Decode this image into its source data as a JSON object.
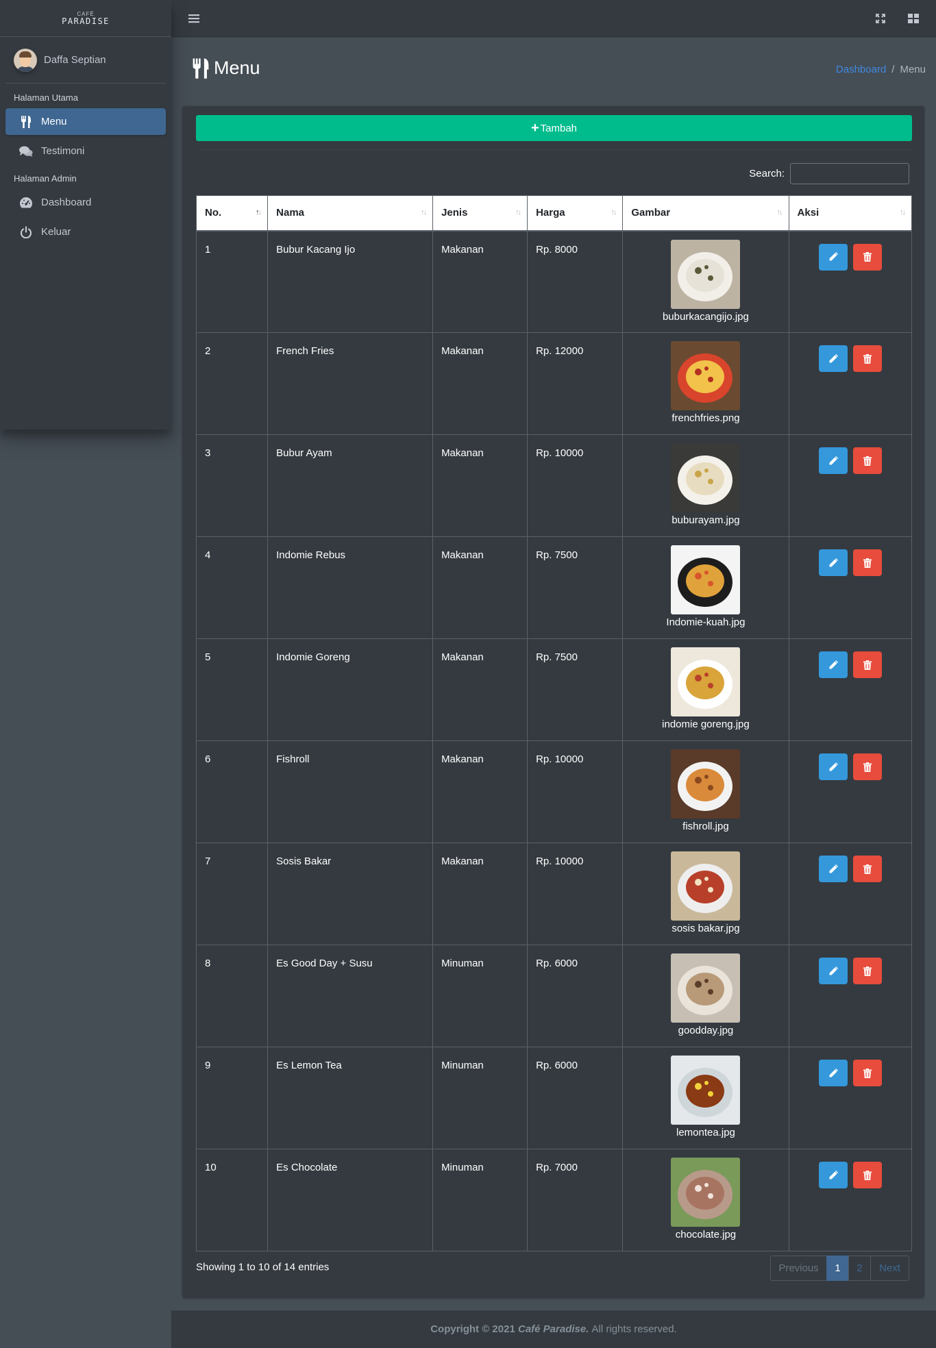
{
  "brand": {
    "line1": "CAFÉ",
    "line2": "PARADISE"
  },
  "user": {
    "name": "Daffa Septian"
  },
  "sidebar": {
    "header_main": "Halaman Utama",
    "header_admin": "Halaman Admin",
    "items": [
      {
        "label": "Menu",
        "icon": "utensils-icon",
        "active": true
      },
      {
        "label": "Testimoni",
        "icon": "comments-icon",
        "active": false
      },
      {
        "label": "Dashboard",
        "icon": "tachometer-icon",
        "active": false
      },
      {
        "label": "Keluar",
        "icon": "power-icon",
        "active": false
      }
    ]
  },
  "page": {
    "title": "Menu"
  },
  "breadcrumb": {
    "home": "Dashboard",
    "sep": "/",
    "current": "Menu"
  },
  "toolbar": {
    "add_label": "Tambah"
  },
  "search": {
    "label": "Search:",
    "value": ""
  },
  "table": {
    "headers": [
      "No.",
      "Nama",
      "Jenis",
      "Harga",
      "Gambar",
      "Aksi"
    ],
    "rows": [
      {
        "no": "1",
        "nama": "Bubur Kacang Ijo",
        "jenis": "Makanan",
        "harga": "Rp. 8000",
        "gambar": "buburkacangijo.jpg"
      },
      {
        "no": "2",
        "nama": "French Fries",
        "jenis": "Makanan",
        "harga": "Rp. 12000",
        "gambar": "frenchfries.png"
      },
      {
        "no": "3",
        "nama": "Bubur Ayam",
        "jenis": "Makanan",
        "harga": "Rp. 10000",
        "gambar": "buburayam.jpg"
      },
      {
        "no": "4",
        "nama": "Indomie Rebus",
        "jenis": "Makanan",
        "harga": "Rp. 7500",
        "gambar": "Indomie-kuah.jpg"
      },
      {
        "no": "5",
        "nama": "Indomie Goreng",
        "jenis": "Makanan",
        "harga": "Rp. 7500",
        "gambar": "indomie goreng.jpg"
      },
      {
        "no": "6",
        "nama": "Fishroll",
        "jenis": "Makanan",
        "harga": "Rp. 10000",
        "gambar": "fishroll.jpg"
      },
      {
        "no": "7",
        "nama": "Sosis Bakar",
        "jenis": "Makanan",
        "harga": "Rp. 10000",
        "gambar": "sosis bakar.jpg"
      },
      {
        "no": "8",
        "nama": "Es Good Day + Susu",
        "jenis": "Minuman",
        "harga": "Rp. 6000",
        "gambar": "goodday.jpg"
      },
      {
        "no": "9",
        "nama": "Es Lemon Tea",
        "jenis": "Minuman",
        "harga": "Rp. 6000",
        "gambar": "lemontea.jpg"
      },
      {
        "no": "10",
        "nama": "Es Chocolate",
        "jenis": "Minuman",
        "harga": "Rp. 7000",
        "gambar": "chocolate.jpg"
      }
    ]
  },
  "info": {
    "text": "Showing 1 to 10 of 14 entries"
  },
  "pagination": {
    "prev": "Previous",
    "pages": [
      "1",
      "2"
    ],
    "next": "Next",
    "current": "1"
  },
  "footer": {
    "copyright": "Copyright © 2021",
    "brand": "Café Paradise.",
    "rights": "All rights reserved."
  },
  "colors": {
    "accent": "#3f6791",
    "add": "#00bc8c",
    "edit": "#3498db",
    "delete": "#e74c3c",
    "link": "#3f8ae0"
  }
}
